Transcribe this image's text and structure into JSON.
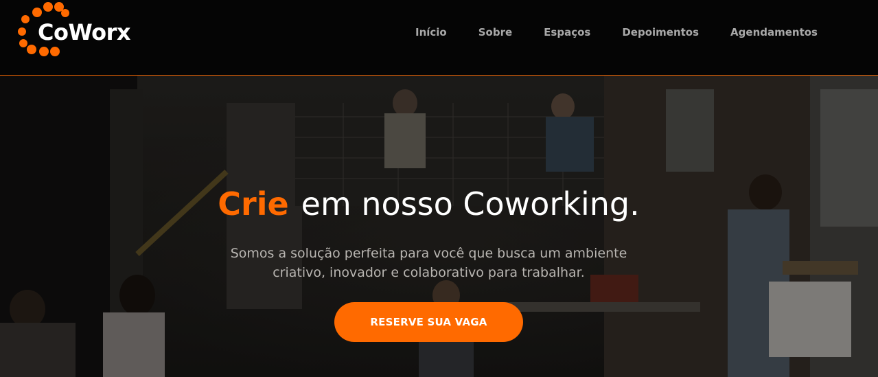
{
  "brand": {
    "name": "CoWorx",
    "accent_color": "#ff6a00",
    "icon": "dotted-ring-logo-icon"
  },
  "nav": {
    "items": [
      {
        "label": "Início"
      },
      {
        "label": "Sobre"
      },
      {
        "label": "Espaços"
      },
      {
        "label": "Depoimentos"
      },
      {
        "label": "Agendamentos"
      }
    ]
  },
  "hero": {
    "title_accent": "Crie",
    "title_rest": "em nosso Coworking.",
    "subtitle_line1": "Somos a solução perfeita para você que busca um ambiente",
    "subtitle_line2": "criativo, inovador e colaborativo para trabalhar.",
    "cta_label": "RESERVE SUA VAGA",
    "background": "coworking-office-photo"
  }
}
